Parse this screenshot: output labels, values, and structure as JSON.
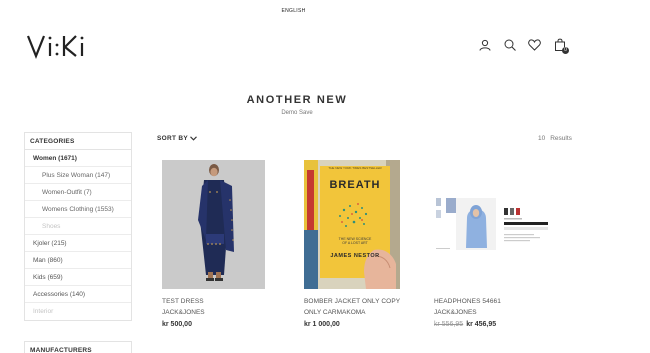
{
  "header": {
    "language": "ENGLISH",
    "logo_text": "Vi:Ki",
    "icons": [
      "user-icon",
      "search-icon",
      "heart-icon",
      "cart-icon"
    ],
    "cart_count": "0"
  },
  "page": {
    "title": "ANOTHER NEW",
    "subtitle": "Demo Save"
  },
  "sidebar": {
    "categories_heading": "CATEGORIES",
    "categories": [
      {
        "label": "Women (1671)",
        "level": 0,
        "style": "bold"
      },
      {
        "label": "Plus Size Woman (147)",
        "level": 1
      },
      {
        "label": "Women-Outfit (7)",
        "level": 1
      },
      {
        "label": "Womens Clothing (1553)",
        "level": 1
      },
      {
        "label": "Shoes",
        "level": 1,
        "style": "muted"
      },
      {
        "label": "Kjoler (215)",
        "level": 0
      },
      {
        "label": "Man (860)",
        "level": 0
      },
      {
        "label": "Kids (659)",
        "level": 0
      },
      {
        "label": "Accessories (140)",
        "level": 0
      },
      {
        "label": "Interior",
        "level": 0,
        "style": "muted"
      }
    ],
    "manufacturers_heading": "MANUFACTURERS"
  },
  "toolbar": {
    "sort_label": "SORT BY",
    "results_count": "10",
    "results_label": "Results"
  },
  "products": [
    {
      "name": "TEST DRESS",
      "brand": "JACK&JONES",
      "price": "kr 500,00",
      "old_price": ""
    },
    {
      "name": "BOMBER JACKET ONLY COPY",
      "brand": "ONLY CARMAKOMA",
      "price": "kr 1 000,00",
      "old_price": ""
    },
    {
      "name": "HEADPHONES 54661",
      "brand": "JACK&JONES",
      "price": "kr 456,95",
      "old_price": "kr 556,95"
    }
  ],
  "book": {
    "top_text": "THE NEW YORK TIMES BESTSELLER",
    "title": "BREATH",
    "subtitle_line1": "THE NEW SCIENCE",
    "subtitle_line2": "OF A LOST ART",
    "author": "JAMES NESTOR"
  },
  "colors": {
    "text": "#333333",
    "border": "#e3e3e3",
    "book_yellow": "#f2c53a"
  }
}
